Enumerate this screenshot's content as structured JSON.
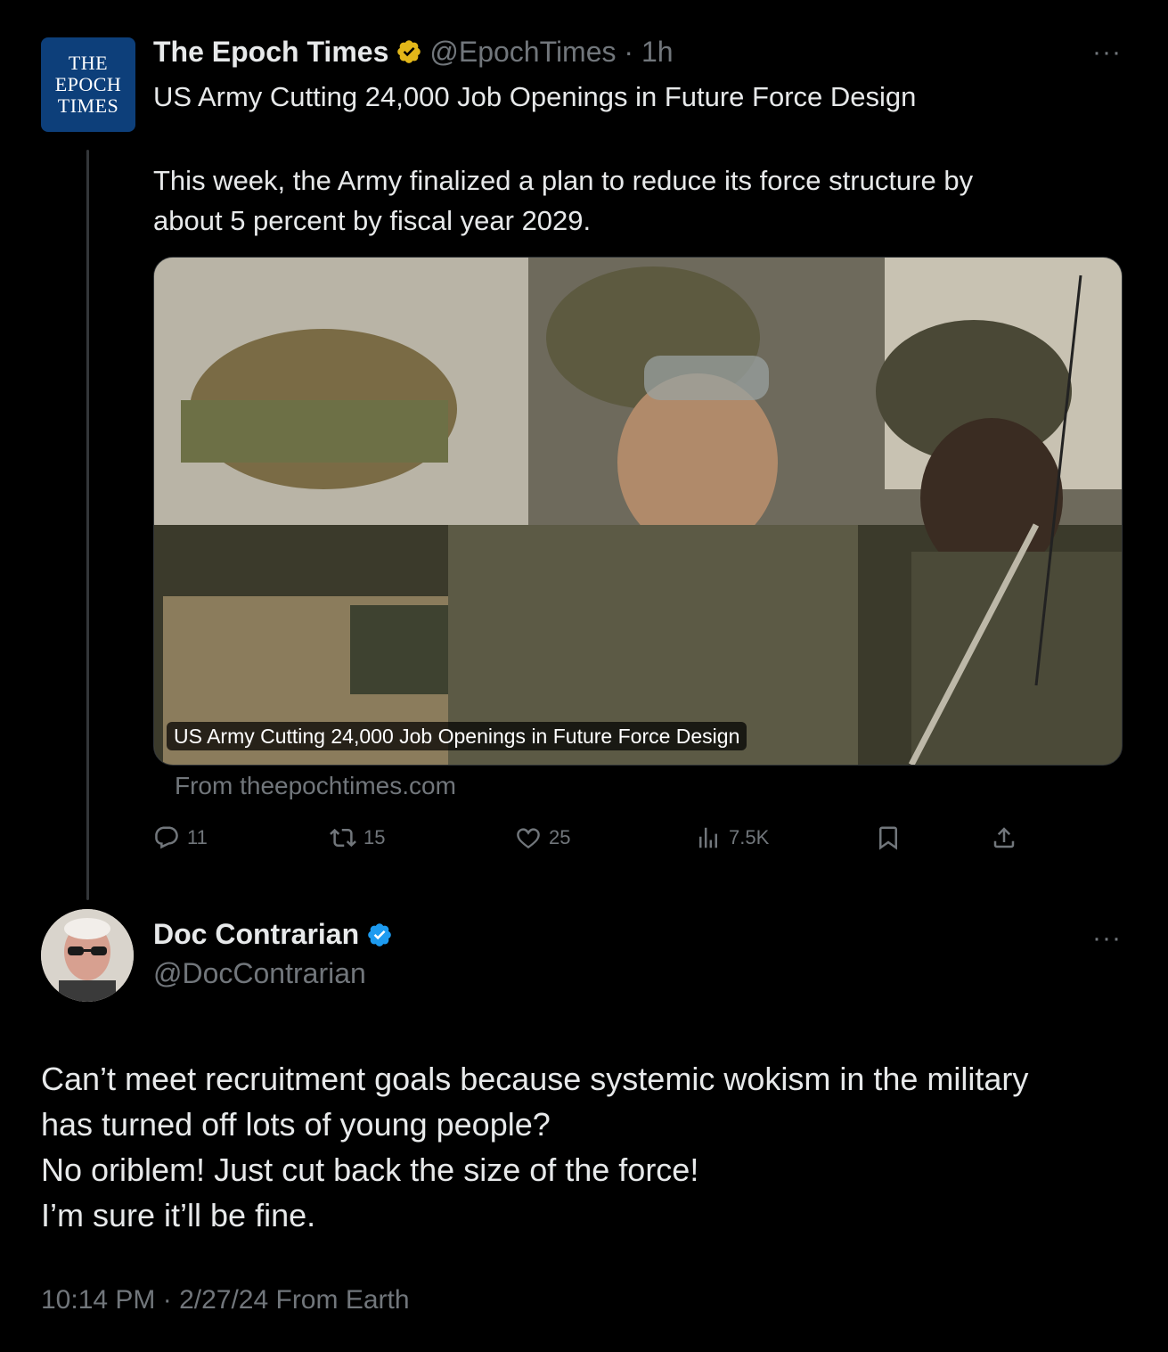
{
  "quoted_tweet": {
    "avatar_text": [
      "THE",
      "EPOCH",
      "TIMES"
    ],
    "name": "The Epoch Times",
    "handle_time": "@EpochTimes · 1h",
    "more": "···",
    "headline": "US Army Cutting 24,000 Job Openings in Future Force Design",
    "body": "This week, the Army finalized a plan to reduce its force structure by\nabout 5 percent by fiscal year 2029.",
    "media_caption": "US Army Cutting 24,000 Job Openings in Future Force Design",
    "from_link": "From theepochtimes.com",
    "actions": {
      "replies": "11",
      "reposts": "15",
      "likes": "25",
      "views": "7.5K"
    },
    "badge_color": "#e2b719"
  },
  "main_tweet": {
    "name": "Doc Contrarian",
    "handle": "@DocContrarian",
    "more": "···",
    "text": "Can’t meet recruitment goals because systemic wokism in the military\nhas turned off lots of young people?\nNo oriblem! Just cut back the size of the force!\nI’m sure it’ll be fine.",
    "timestamp": "10:14 PM · 2/27/24 From Earth",
    "badge_color": "#1d9bf0"
  }
}
